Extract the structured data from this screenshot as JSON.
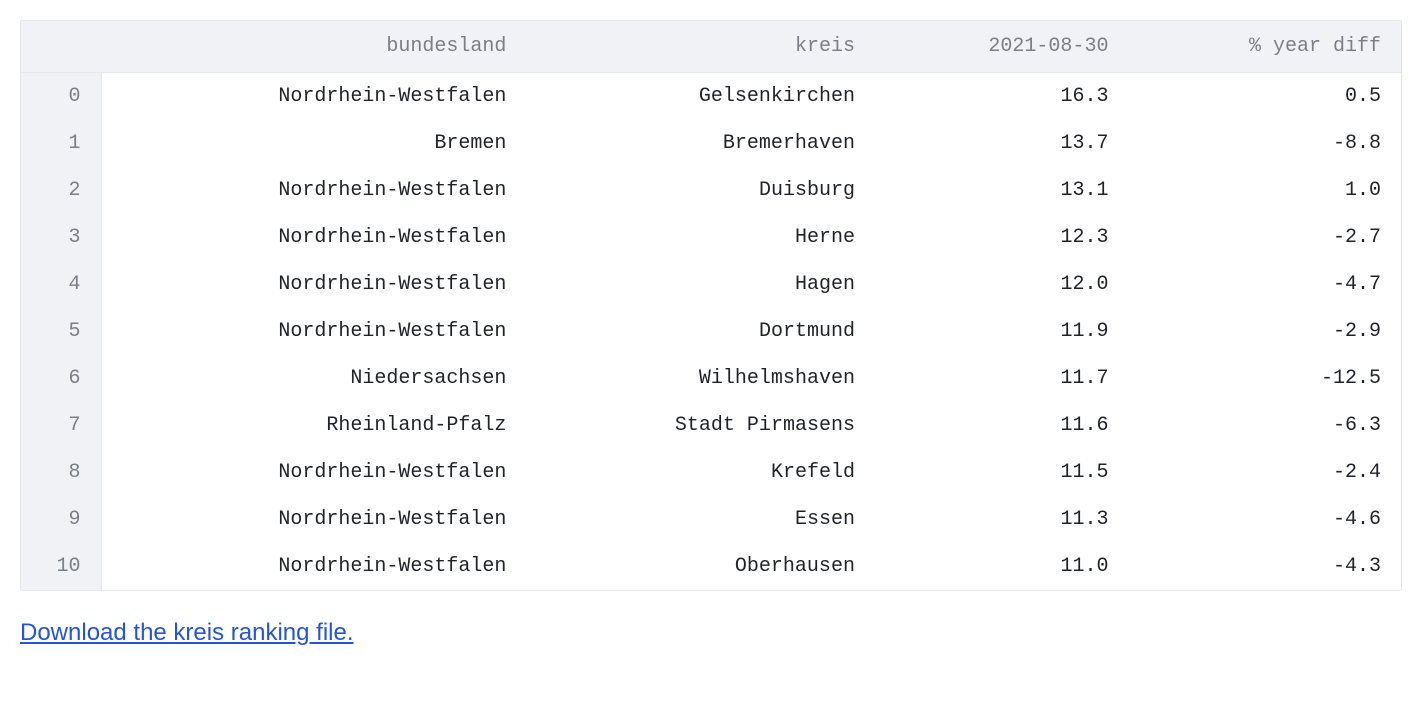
{
  "table": {
    "headers": {
      "idx": "",
      "bundesland": "bundesland",
      "kreis": "kreis",
      "date": "2021-08-30",
      "diff": "% year diff"
    },
    "rows": [
      {
        "idx": "0",
        "bundesland": "Nordrhein-Westfalen",
        "kreis": "Gelsenkirchen",
        "date": "16.3",
        "diff": "0.5"
      },
      {
        "idx": "1",
        "bundesland": "Bremen",
        "kreis": "Bremerhaven",
        "date": "13.7",
        "diff": "-8.8"
      },
      {
        "idx": "2",
        "bundesland": "Nordrhein-Westfalen",
        "kreis": "Duisburg",
        "date": "13.1",
        "diff": "1.0"
      },
      {
        "idx": "3",
        "bundesland": "Nordrhein-Westfalen",
        "kreis": "Herne",
        "date": "12.3",
        "diff": "-2.7"
      },
      {
        "idx": "4",
        "bundesland": "Nordrhein-Westfalen",
        "kreis": "Hagen",
        "date": "12.0",
        "diff": "-4.7"
      },
      {
        "idx": "5",
        "bundesland": "Nordrhein-Westfalen",
        "kreis": "Dortmund",
        "date": "11.9",
        "diff": "-2.9"
      },
      {
        "idx": "6",
        "bundesland": "Niedersachsen",
        "kreis": "Wilhelmshaven",
        "date": "11.7",
        "diff": "-12.5"
      },
      {
        "idx": "7",
        "bundesland": "Rheinland-Pfalz",
        "kreis": "Stadt Pirmasens",
        "date": "11.6",
        "diff": "-6.3"
      },
      {
        "idx": "8",
        "bundesland": "Nordrhein-Westfalen",
        "kreis": "Krefeld",
        "date": "11.5",
        "diff": "-2.4"
      },
      {
        "idx": "9",
        "bundesland": "Nordrhein-Westfalen",
        "kreis": "Essen",
        "date": "11.3",
        "diff": "-4.6"
      },
      {
        "idx": "10",
        "bundesland": "Nordrhein-Westfalen",
        "kreis": "Oberhausen",
        "date": "11.0",
        "diff": "-4.3"
      }
    ]
  },
  "link": {
    "label": "Download the kreis ranking file."
  }
}
